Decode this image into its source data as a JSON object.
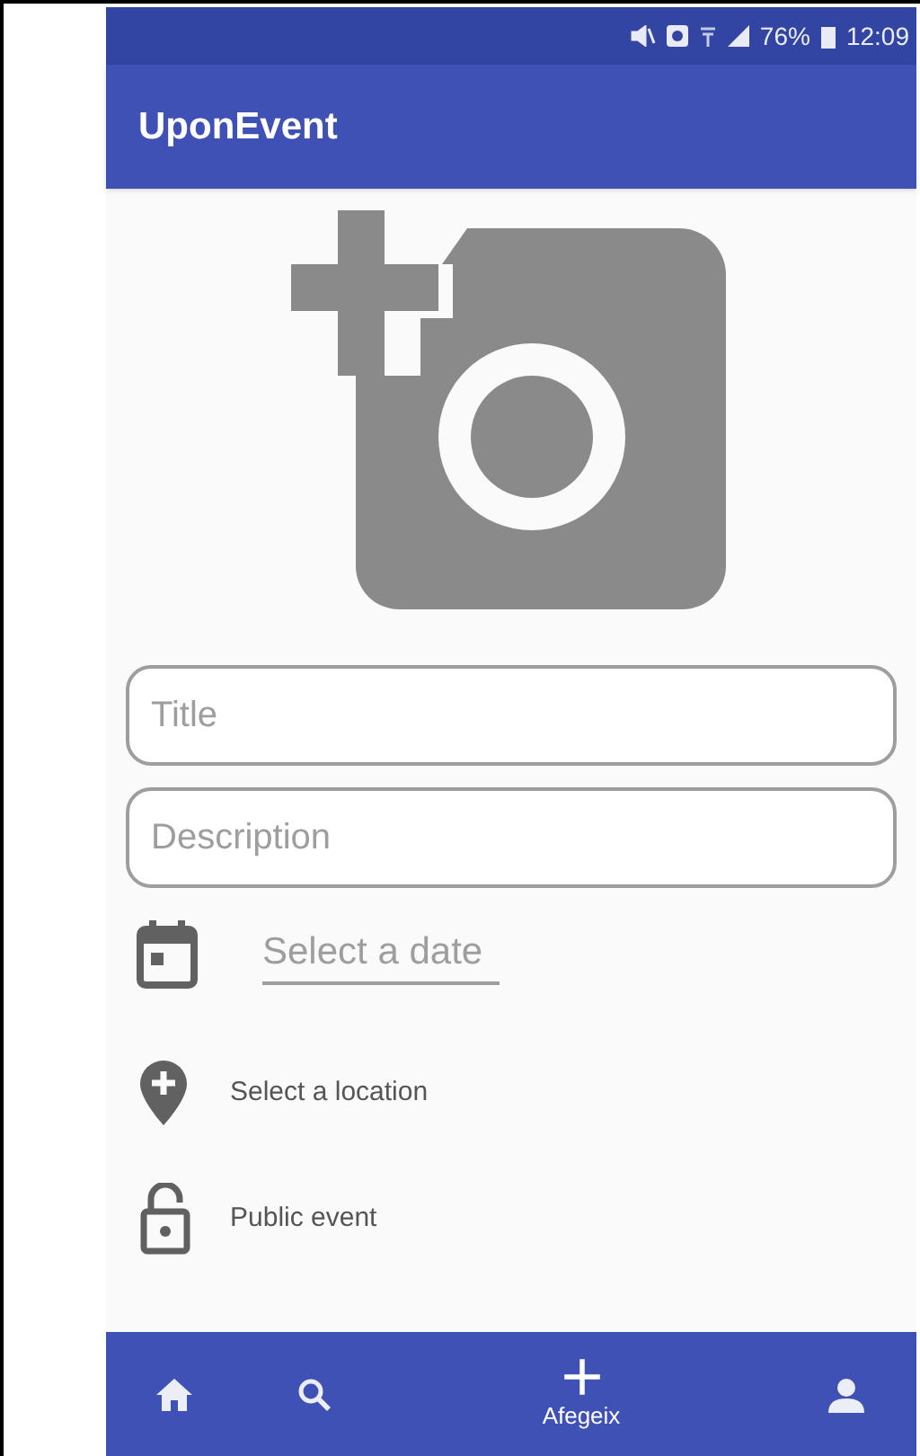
{
  "status_bar": {
    "battery": "76%",
    "time": "12:09"
  },
  "app_bar": {
    "title": "UponEvent"
  },
  "form": {
    "title_field": {
      "placeholder": "Title"
    },
    "description_field": {
      "placeholder": "Description"
    },
    "date": {
      "placeholder": "Select a date"
    },
    "location": {
      "label": "Select a location"
    },
    "visibility": {
      "label": "Public event"
    }
  },
  "bottom_nav": [
    {
      "kind": "home",
      "selected": false
    },
    {
      "kind": "search",
      "selected": false
    },
    {
      "kind": "add",
      "selected": true,
      "label": "Afegeix"
    },
    {
      "kind": "profile",
      "selected": false
    }
  ]
}
